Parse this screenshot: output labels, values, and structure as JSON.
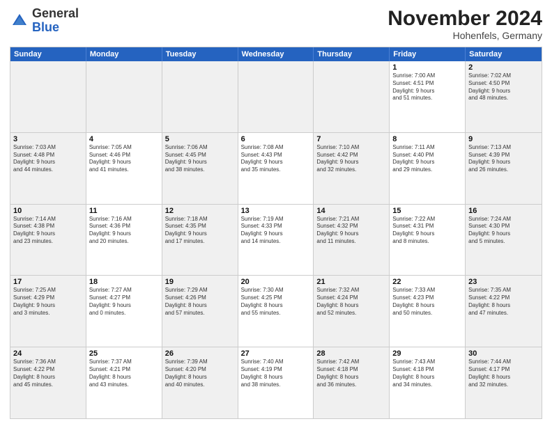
{
  "logo": {
    "general": "General",
    "blue": "Blue"
  },
  "header": {
    "month": "November 2024",
    "location": "Hohenfels, Germany"
  },
  "weekdays": [
    "Sunday",
    "Monday",
    "Tuesday",
    "Wednesday",
    "Thursday",
    "Friday",
    "Saturday"
  ],
  "rows": [
    [
      {
        "day": "",
        "info": "",
        "shaded": true
      },
      {
        "day": "",
        "info": "",
        "shaded": true
      },
      {
        "day": "",
        "info": "",
        "shaded": true
      },
      {
        "day": "",
        "info": "",
        "shaded": true
      },
      {
        "day": "",
        "info": "",
        "shaded": true
      },
      {
        "day": "1",
        "info": "Sunrise: 7:00 AM\nSunset: 4:51 PM\nDaylight: 9 hours\nand 51 minutes."
      },
      {
        "day": "2",
        "info": "Sunrise: 7:02 AM\nSunset: 4:50 PM\nDaylight: 9 hours\nand 48 minutes.",
        "shaded": true
      }
    ],
    [
      {
        "day": "3",
        "info": "Sunrise: 7:03 AM\nSunset: 4:48 PM\nDaylight: 9 hours\nand 44 minutes.",
        "shaded": true
      },
      {
        "day": "4",
        "info": "Sunrise: 7:05 AM\nSunset: 4:46 PM\nDaylight: 9 hours\nand 41 minutes."
      },
      {
        "day": "5",
        "info": "Sunrise: 7:06 AM\nSunset: 4:45 PM\nDaylight: 9 hours\nand 38 minutes.",
        "shaded": true
      },
      {
        "day": "6",
        "info": "Sunrise: 7:08 AM\nSunset: 4:43 PM\nDaylight: 9 hours\nand 35 minutes."
      },
      {
        "day": "7",
        "info": "Sunrise: 7:10 AM\nSunset: 4:42 PM\nDaylight: 9 hours\nand 32 minutes.",
        "shaded": true
      },
      {
        "day": "8",
        "info": "Sunrise: 7:11 AM\nSunset: 4:40 PM\nDaylight: 9 hours\nand 29 minutes."
      },
      {
        "day": "9",
        "info": "Sunrise: 7:13 AM\nSunset: 4:39 PM\nDaylight: 9 hours\nand 26 minutes.",
        "shaded": true
      }
    ],
    [
      {
        "day": "10",
        "info": "Sunrise: 7:14 AM\nSunset: 4:38 PM\nDaylight: 9 hours\nand 23 minutes.",
        "shaded": true
      },
      {
        "day": "11",
        "info": "Sunrise: 7:16 AM\nSunset: 4:36 PM\nDaylight: 9 hours\nand 20 minutes."
      },
      {
        "day": "12",
        "info": "Sunrise: 7:18 AM\nSunset: 4:35 PM\nDaylight: 9 hours\nand 17 minutes.",
        "shaded": true
      },
      {
        "day": "13",
        "info": "Sunrise: 7:19 AM\nSunset: 4:33 PM\nDaylight: 9 hours\nand 14 minutes."
      },
      {
        "day": "14",
        "info": "Sunrise: 7:21 AM\nSunset: 4:32 PM\nDaylight: 9 hours\nand 11 minutes.",
        "shaded": true
      },
      {
        "day": "15",
        "info": "Sunrise: 7:22 AM\nSunset: 4:31 PM\nDaylight: 9 hours\nand 8 minutes."
      },
      {
        "day": "16",
        "info": "Sunrise: 7:24 AM\nSunset: 4:30 PM\nDaylight: 9 hours\nand 5 minutes.",
        "shaded": true
      }
    ],
    [
      {
        "day": "17",
        "info": "Sunrise: 7:25 AM\nSunset: 4:29 PM\nDaylight: 9 hours\nand 3 minutes.",
        "shaded": true
      },
      {
        "day": "18",
        "info": "Sunrise: 7:27 AM\nSunset: 4:27 PM\nDaylight: 9 hours\nand 0 minutes."
      },
      {
        "day": "19",
        "info": "Sunrise: 7:29 AM\nSunset: 4:26 PM\nDaylight: 8 hours\nand 57 minutes.",
        "shaded": true
      },
      {
        "day": "20",
        "info": "Sunrise: 7:30 AM\nSunset: 4:25 PM\nDaylight: 8 hours\nand 55 minutes."
      },
      {
        "day": "21",
        "info": "Sunrise: 7:32 AM\nSunset: 4:24 PM\nDaylight: 8 hours\nand 52 minutes.",
        "shaded": true
      },
      {
        "day": "22",
        "info": "Sunrise: 7:33 AM\nSunset: 4:23 PM\nDaylight: 8 hours\nand 50 minutes."
      },
      {
        "day": "23",
        "info": "Sunrise: 7:35 AM\nSunset: 4:22 PM\nDaylight: 8 hours\nand 47 minutes.",
        "shaded": true
      }
    ],
    [
      {
        "day": "24",
        "info": "Sunrise: 7:36 AM\nSunset: 4:22 PM\nDaylight: 8 hours\nand 45 minutes.",
        "shaded": true
      },
      {
        "day": "25",
        "info": "Sunrise: 7:37 AM\nSunset: 4:21 PM\nDaylight: 8 hours\nand 43 minutes."
      },
      {
        "day": "26",
        "info": "Sunrise: 7:39 AM\nSunset: 4:20 PM\nDaylight: 8 hours\nand 40 minutes.",
        "shaded": true
      },
      {
        "day": "27",
        "info": "Sunrise: 7:40 AM\nSunset: 4:19 PM\nDaylight: 8 hours\nand 38 minutes."
      },
      {
        "day": "28",
        "info": "Sunrise: 7:42 AM\nSunset: 4:18 PM\nDaylight: 8 hours\nand 36 minutes.",
        "shaded": true
      },
      {
        "day": "29",
        "info": "Sunrise: 7:43 AM\nSunset: 4:18 PM\nDaylight: 8 hours\nand 34 minutes."
      },
      {
        "day": "30",
        "info": "Sunrise: 7:44 AM\nSunset: 4:17 PM\nDaylight: 8 hours\nand 32 minutes.",
        "shaded": true
      }
    ]
  ]
}
